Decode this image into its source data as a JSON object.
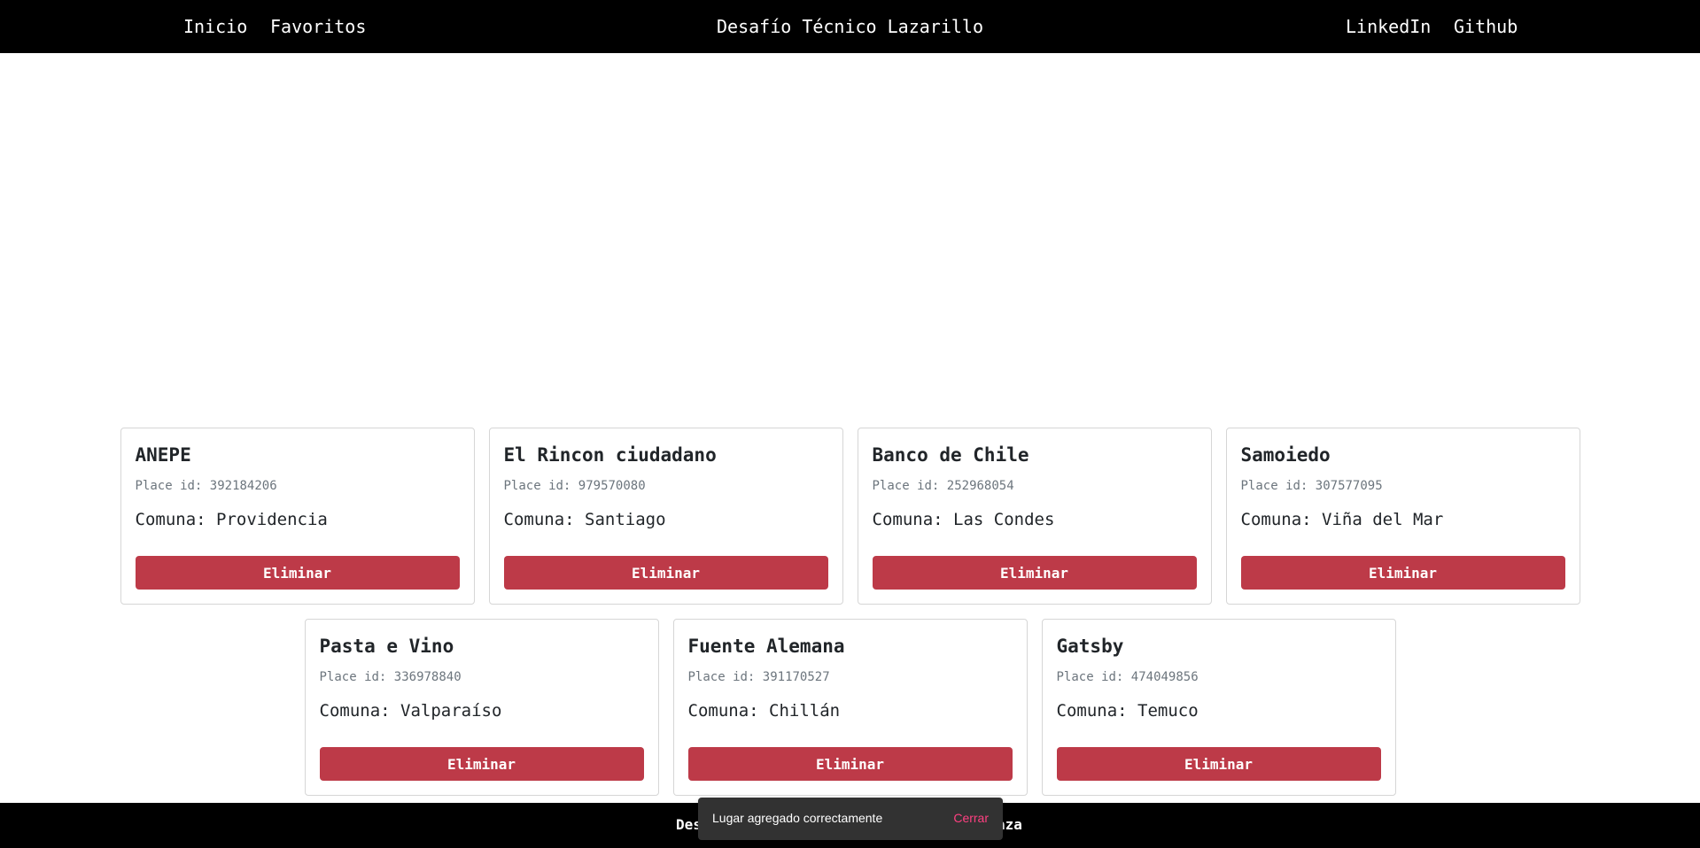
{
  "header": {
    "nav_left": [
      "Inicio",
      "Favoritos"
    ],
    "title": "Desafío Técnico Lazarillo",
    "nav_right": [
      "LinkedIn",
      "Github"
    ]
  },
  "cards": [
    {
      "name": "ANEPE",
      "place_id": "Place id: 392184206",
      "comuna": "Comuna: Providencia",
      "button": "Eliminar"
    },
    {
      "name": "El Rincon ciudadano",
      "place_id": "Place id: 979570080",
      "comuna": "Comuna: Santiago",
      "button": "Eliminar"
    },
    {
      "name": "Banco de Chile",
      "place_id": "Place id: 252968054",
      "comuna": "Comuna: Las Condes",
      "button": "Eliminar"
    },
    {
      "name": "Samoiedo",
      "place_id": "Place id: 307577095",
      "comuna": "Comuna: Viña del Mar",
      "button": "Eliminar"
    },
    {
      "name": "Pasta e Vino",
      "place_id": "Place id: 336978840",
      "comuna": "Comuna: Valparaíso",
      "button": "Eliminar"
    },
    {
      "name": "Fuente Alemana",
      "place_id": "Place id: 391170527",
      "comuna": "Comuna: Chillán",
      "button": "Eliminar"
    },
    {
      "name": "Gatsby",
      "place_id": "Place id: 474049856",
      "comuna": "Comuna: Temuco",
      "button": "Eliminar"
    }
  ],
  "footer": {
    "text_left": "Des",
    "text_right": "aza"
  },
  "snackbar": {
    "message": "Lugar agregado correctamente",
    "action": "Cerrar"
  },
  "colors": {
    "navbar_bg": "#000000",
    "button_bg": "#bd3a48",
    "snackbar_bg": "#323232",
    "snackbar_action": "#ff4081"
  }
}
